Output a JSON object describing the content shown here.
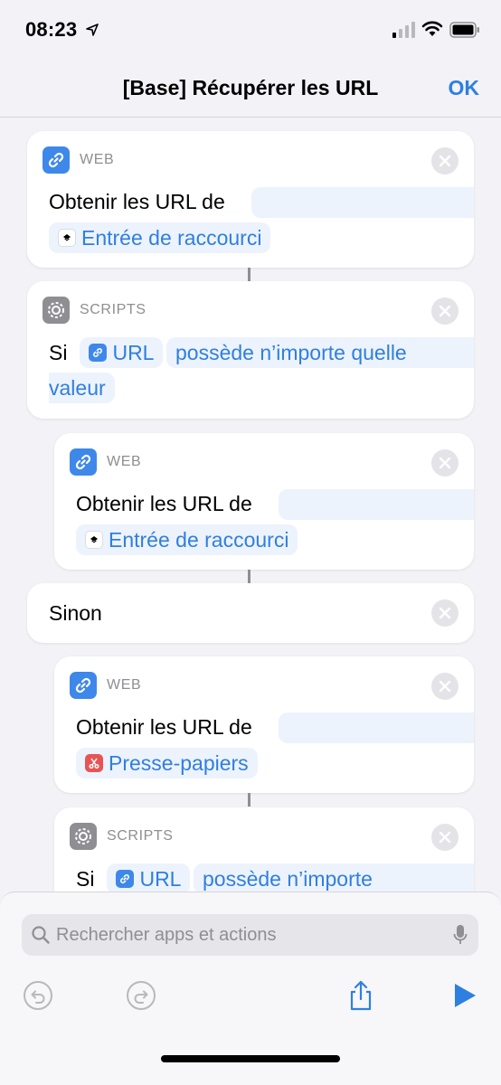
{
  "status": {
    "time": "08:23"
  },
  "nav": {
    "title": "[Base] Récupérer les URL",
    "ok": "OK"
  },
  "actions": [
    {
      "category": "WEB",
      "verb": "Obtenir les URL de",
      "param": "Entrée de raccourci"
    },
    {
      "category": "SCRIPTS",
      "prefix": "Si",
      "var": "URL",
      "condition": "possède n’importe quelle",
      "cont": "valeur"
    },
    {
      "category": "WEB",
      "verb": "Obtenir les URL de",
      "param": "Entrée de raccourci"
    },
    {
      "label": "Sinon"
    },
    {
      "category": "WEB",
      "verb": "Obtenir les URL de",
      "param": "Presse-papiers"
    },
    {
      "category": "SCRIPTS",
      "prefix": "Si",
      "var": "URL",
      "condition": "possède n’importe"
    }
  ],
  "search": {
    "placeholder": "Rechercher apps et actions"
  },
  "colors": {
    "accent": "#2f7fe0",
    "web_icon": "#3e88ea",
    "scripts_icon": "#8e8e93",
    "clipboard_icon": "#e85454"
  },
  "icons": [
    "location-arrow-icon",
    "signal-icon",
    "wifi-icon",
    "battery-icon",
    "link-icon",
    "gear-icon",
    "close-icon",
    "shortcut-input-icon",
    "scissors-icon",
    "search-icon",
    "microphone-icon",
    "undo-icon",
    "redo-icon",
    "share-icon",
    "play-icon"
  ]
}
